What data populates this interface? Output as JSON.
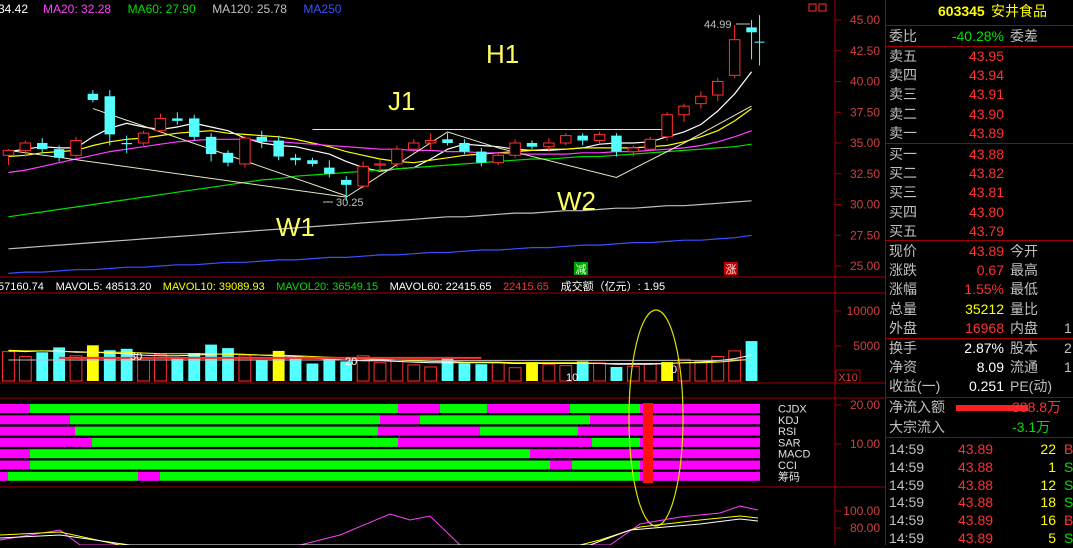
{
  "main": {
    "ma_legend": [
      {
        "text": "34.42",
        "color": "#ffffff"
      },
      {
        "text": "MA20: 32.28",
        "color": "#ff40ff"
      },
      {
        "text": "MA60: 27.90",
        "color": "#00e000"
      },
      {
        "text": "MA120: 25.78",
        "color": "#c0c0c0"
      },
      {
        "text": "MA250",
        "color": "#3a50ff"
      }
    ],
    "price_axis": [
      "45.00",
      "42.50",
      "40.00",
      "37.50",
      "35.00",
      "32.50",
      "30.00",
      "27.50",
      "25.00"
    ],
    "high_label": "44.99",
    "low_label": "30.25",
    "annotations": [
      "H1",
      "J1",
      "W1",
      "W2"
    ],
    "events": [
      "减",
      "涨"
    ]
  },
  "volume": {
    "legend": [
      {
        "text": "57160.74",
        "color": "#ffffff"
      },
      {
        "text": "MAVOL5: 48513.20",
        "color": "#ffffff"
      },
      {
        "text": "MAVOL10: 39089.93",
        "color": "#ffff00"
      },
      {
        "text": "MAVOL20: 36549.15",
        "color": "#00e000"
      },
      {
        "text": "MAVOL60: 22415.65",
        "color": "#ffffff"
      },
      {
        "text": "22415.65",
        "color": "#ff3030"
      },
      {
        "text": "成交额（亿元）: 1.95",
        "color": "#ffffff"
      }
    ],
    "axis": [
      "10000",
      "5000"
    ],
    "unit": "X10",
    "marks": [
      "30",
      "20",
      "10",
      "0"
    ]
  },
  "indicators": {
    "names": [
      "CJDX",
      "KDJ",
      "RSI",
      "SAR",
      "MACD",
      "CCI",
      "筹码"
    ],
    "axis": [
      "20.00",
      "10.00"
    ]
  },
  "osc": {
    "axis": [
      "100.00",
      "80.00"
    ]
  },
  "quote": {
    "code": "603345",
    "name": "安井食品",
    "weibi_label": "委比",
    "weibi_value": "-40.28%",
    "weicha_label": "委差",
    "asks": [
      {
        "label": "卖五",
        "price": "43.95"
      },
      {
        "label": "卖四",
        "price": "43.94"
      },
      {
        "label": "卖三",
        "price": "43.91"
      },
      {
        "label": "卖二",
        "price": "43.90"
      },
      {
        "label": "卖一",
        "price": "43.89"
      }
    ],
    "bids": [
      {
        "label": "买一",
        "price": "43.88"
      },
      {
        "label": "买二",
        "price": "43.82"
      },
      {
        "label": "买三",
        "price": "43.81"
      },
      {
        "label": "买四",
        "price": "43.80"
      },
      {
        "label": "买五",
        "price": "43.79"
      }
    ],
    "stats": [
      {
        "label": "现价",
        "value": "43.89",
        "color": "red",
        "label2": "今开",
        "value2": ""
      },
      {
        "label": "涨跌",
        "value": "0.67",
        "color": "red",
        "label2": "最高",
        "value2": ""
      },
      {
        "label": "涨幅",
        "value": "1.55%",
        "color": "red",
        "label2": "最低",
        "value2": ""
      },
      {
        "label": "总量",
        "value": "35212",
        "color": "yel",
        "label2": "量比",
        "value2": ""
      },
      {
        "label": "外盘",
        "value": "16968",
        "color": "red",
        "label2": "内盘",
        "value2": "1"
      }
    ],
    "stats2": [
      {
        "label": "换手",
        "value": "2.87%",
        "color": "wht",
        "label2": "股本",
        "value2": "2"
      },
      {
        "label": "净资",
        "value": "8.09",
        "color": "wht",
        "label2": "流通",
        "value2": "1"
      },
      {
        "label": "收益(一)",
        "value": "0.251",
        "color": "wht",
        "label2": "PE(动)",
        "value2": ""
      }
    ],
    "flow": [
      {
        "label": "净流入额",
        "value": "388.8万",
        "color": "red"
      },
      {
        "label": "大宗流入",
        "value": "-3.1万",
        "color": "grn"
      }
    ],
    "trades": [
      {
        "time": "14:59",
        "price": "43.89",
        "vol": "22",
        "dir": "B",
        "dcolor": "red"
      },
      {
        "time": "14:59",
        "price": "43.88",
        "vol": "1",
        "dir": "S",
        "dcolor": "grn"
      },
      {
        "time": "14:59",
        "price": "43.88",
        "vol": "12",
        "dir": "S",
        "dcolor": "grn"
      },
      {
        "time": "14:59",
        "price": "43.88",
        "vol": "18",
        "dir": "S",
        "dcolor": "grn"
      },
      {
        "time": "14:59",
        "price": "43.89",
        "vol": "16",
        "dir": "B",
        "dcolor": "red"
      },
      {
        "time": "14:59",
        "price": "43.89",
        "vol": "5",
        "dir": "S",
        "dcolor": "grn"
      }
    ]
  },
  "chart_data": {
    "type": "candlestick",
    "y_axis_range": [
      24,
      46.5
    ],
    "candles": [
      [
        34.0,
        34.5,
        33.2,
        34.4
      ],
      [
        34.4,
        35.2,
        33.9,
        35.0
      ],
      [
        35.0,
        35.4,
        34.2,
        34.5
      ],
      [
        34.5,
        34.8,
        33.5,
        33.8
      ],
      [
        34.0,
        35.5,
        33.8,
        35.2
      ],
      [
        39.0,
        39.3,
        38.3,
        38.5
      ],
      [
        38.8,
        39.3,
        34.8,
        35.7
      ],
      [
        35.0,
        35.6,
        34.2,
        34.9
      ],
      [
        35.0,
        36.0,
        34.8,
        35.8
      ],
      [
        36.0,
        37.4,
        35.8,
        37.0
      ],
      [
        37.0,
        37.5,
        36.5,
        36.8
      ],
      [
        37.0,
        37.3,
        35.2,
        35.5
      ],
      [
        35.5,
        35.8,
        33.5,
        34.1
      ],
      [
        34.2,
        34.4,
        33.1,
        33.4
      ],
      [
        33.3,
        35.6,
        33.0,
        35.4
      ],
      [
        35.5,
        36.0,
        34.6,
        35.1
      ],
      [
        35.2,
        35.6,
        33.6,
        33.9
      ],
      [
        33.8,
        34.1,
        33.2,
        33.6
      ],
      [
        33.6,
        33.8,
        33.1,
        33.3
      ],
      [
        33.0,
        33.6,
        32.2,
        32.5
      ],
      [
        32.0,
        32.3,
        30.3,
        31.6
      ],
      [
        31.5,
        33.5,
        31.3,
        33.1
      ],
      [
        33.2,
        33.6,
        32.7,
        33.3
      ],
      [
        33.3,
        34.8,
        33.0,
        34.5
      ],
      [
        34.5,
        35.3,
        34.2,
        35.0
      ],
      [
        35.0,
        35.8,
        34.5,
        35.2
      ],
      [
        35.3,
        35.8,
        34.8,
        35.0
      ],
      [
        35.0,
        35.3,
        34.1,
        34.3
      ],
      [
        34.3,
        34.6,
        33.1,
        33.4
      ],
      [
        33.4,
        34.2,
        33.2,
        34.0
      ],
      [
        34.0,
        35.3,
        33.8,
        35.0
      ],
      [
        35.0,
        35.2,
        34.5,
        34.7
      ],
      [
        34.7,
        35.4,
        34.3,
        35.0
      ],
      [
        35.0,
        35.8,
        34.8,
        35.6
      ],
      [
        35.6,
        35.8,
        34.8,
        35.2
      ],
      [
        35.2,
        35.9,
        34.9,
        35.7
      ],
      [
        35.6,
        35.8,
        33.9,
        34.3
      ],
      [
        34.3,
        34.8,
        33.9,
        34.6
      ],
      [
        34.5,
        35.5,
        34.3,
        35.3
      ],
      [
        35.5,
        37.5,
        35.2,
        37.3
      ],
      [
        37.3,
        38.2,
        36.7,
        38.0
      ],
      [
        38.2,
        39.2,
        37.8,
        38.8
      ],
      [
        38.9,
        40.3,
        38.4,
        40.0
      ],
      [
        40.5,
        44.6,
        40.3,
        43.4
      ],
      [
        44.4,
        44.99,
        41.8,
        44.0
      ]
    ],
    "ma_lines": [
      {
        "name": "MA5",
        "color": "#ffffff",
        "values": [
          34.3,
          34.5,
          34.7,
          34.6,
          34.6,
          35.5,
          36.2,
          36.6,
          36.3,
          36.1,
          36.3,
          36.6,
          36.3,
          36.0,
          35.4,
          35.0,
          34.8,
          34.7,
          34.4,
          34.1,
          33.5,
          33.0,
          32.7,
          32.9,
          33.0,
          33.7,
          34.5,
          34.9,
          34.8,
          34.7,
          34.5,
          34.4,
          34.4,
          34.5,
          34.6,
          34.9,
          35.0,
          35.0,
          35.1,
          35.5,
          35.9,
          36.5,
          37.6,
          39.0,
          40.8
        ]
      },
      {
        "name": "MA10",
        "color": "#ffff00",
        "values": [
          33.9,
          34.0,
          34.2,
          34.3,
          34.4,
          34.8,
          35.1,
          35.3,
          35.4,
          35.6,
          35.8,
          35.9,
          36.0,
          35.8,
          35.7,
          35.6,
          35.5,
          35.3,
          35.0,
          34.7,
          34.3,
          34.0,
          33.7,
          33.5,
          33.4,
          33.6,
          33.8,
          34.0,
          34.1,
          34.2,
          34.3,
          34.4,
          34.5,
          34.5,
          34.6,
          34.6,
          34.6,
          34.6,
          34.7,
          34.8,
          35.1,
          35.5,
          36.0,
          36.8,
          37.8
        ]
      },
      {
        "name": "MA20",
        "color": "#ff40ff",
        "values": [
          32.6,
          32.8,
          33.1,
          33.4,
          33.7,
          34.0,
          34.3,
          34.5,
          34.7,
          34.9,
          35.1,
          35.2,
          35.3,
          35.3,
          35.3,
          35.2,
          35.1,
          35.0,
          34.9,
          34.8,
          34.7,
          34.6,
          34.5,
          34.5,
          34.4,
          34.4,
          34.3,
          34.3,
          34.2,
          34.2,
          34.1,
          34.1,
          34.1,
          34.1,
          34.2,
          34.2,
          34.3,
          34.3,
          34.4,
          34.5,
          34.6,
          34.8,
          35.1,
          35.5,
          36.0
        ]
      },
      {
        "name": "MA60",
        "color": "#00e000",
        "values": [
          29.0,
          29.2,
          29.4,
          29.6,
          29.8,
          30.0,
          30.2,
          30.4,
          30.6,
          30.8,
          31.0,
          31.2,
          31.4,
          31.6,
          31.8,
          32.0,
          32.1,
          32.3,
          32.4,
          32.5,
          32.6,
          32.7,
          32.8,
          32.9,
          33.0,
          33.1,
          33.2,
          33.3,
          33.4,
          33.5,
          33.6,
          33.7,
          33.7,
          33.8,
          33.9,
          33.9,
          34.0,
          34.1,
          34.2,
          34.3,
          34.4,
          34.5,
          34.6,
          34.7,
          34.9
        ]
      },
      {
        "name": "MA120",
        "color": "#c0c0c0",
        "values": [
          26.4,
          26.5,
          26.6,
          26.7,
          26.8,
          26.9,
          27.0,
          27.1,
          27.2,
          27.3,
          27.4,
          27.5,
          27.6,
          27.7,
          27.8,
          27.9,
          28.0,
          28.1,
          28.2,
          28.3,
          28.4,
          28.5,
          28.6,
          28.7,
          28.8,
          28.9,
          29.0,
          29.0,
          29.1,
          29.2,
          29.3,
          29.3,
          29.4,
          29.5,
          29.5,
          29.6,
          29.7,
          29.7,
          29.8,
          29.9,
          29.9,
          30.0,
          30.1,
          30.2,
          30.3
        ]
      },
      {
        "name": "MA250",
        "color": "#3a50ff",
        "values": [
          24.4,
          24.5,
          24.5,
          24.6,
          24.7,
          24.7,
          24.8,
          24.9,
          24.9,
          25.0,
          25.1,
          25.1,
          25.2,
          25.3,
          25.3,
          25.4,
          25.5,
          25.5,
          25.6,
          25.7,
          25.7,
          25.8,
          25.9,
          25.9,
          26.0,
          26.1,
          26.1,
          26.2,
          26.3,
          26.3,
          26.4,
          26.5,
          26.5,
          26.6,
          26.7,
          26.7,
          26.8,
          26.9,
          26.9,
          27.0,
          27.1,
          27.1,
          27.2,
          27.3,
          27.5
        ]
      }
    ],
    "volumes": [
      4200,
      3500,
      4100,
      4800,
      3600,
      5100,
      4400,
      4600,
      3000,
      3800,
      3200,
      4000,
      5200,
      4700,
      3600,
      3000,
      4300,
      3300,
      2500,
      3100,
      2800,
      3600,
      2600,
      3000,
      2300,
      2000,
      3300,
      2500,
      2400,
      2600,
      1900,
      2700,
      2400,
      2200,
      2800,
      2600,
      2000,
      2100,
      2500,
      2700,
      3100,
      2800,
      3500,
      4300,
      5700
    ]
  }
}
